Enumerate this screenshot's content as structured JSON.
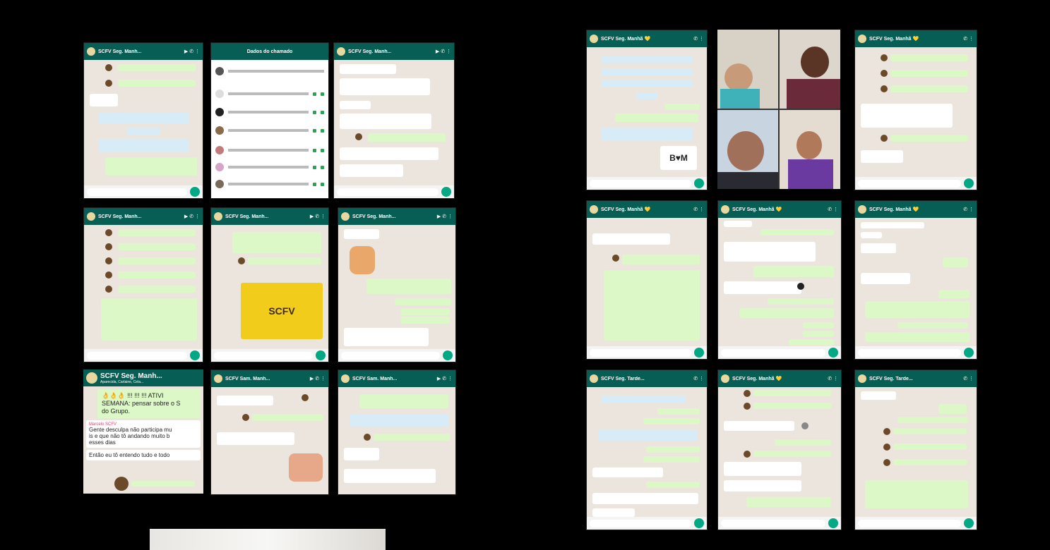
{
  "image": {
    "background": "#000000",
    "accent": "#075e54",
    "bubble_out": "#dcf8c6",
    "bubble_in": "#ffffff",
    "send_button": "#00a884"
  },
  "left_collage": {
    "row1": [
      {
        "title": "SCFV Seg. Manh..."
      },
      {
        "title": "Dados do chamado"
      },
      {
        "title": "SCFV Seg. Manh..."
      }
    ],
    "row2": [
      {
        "title": "SCFV Seg. Manh..."
      },
      {
        "title": "SCFV Seg. Manh..."
      },
      {
        "title": "SCFV Seg. Manh..."
      }
    ],
    "row3": [
      {
        "title": "SCFV Seg. Manh...",
        "subtitle": "Aparecida, Carlaine, Cela...",
        "emoji_line": "👌👌👌 !!! !!! !!! ATIVI",
        "text1": "SEMANA: pensar sobre o S",
        "text2": "do Grupo.",
        "sender": "Marcelo SCFV",
        "msg1": "Gente desculpa não participa mu",
        "msg2": "is e que não tô andando muito b",
        "msg3": "esses dias",
        "msg4": "Então eu tô entendo tudo e todo"
      },
      {
        "title": "SCFV Sam. Manh..."
      },
      {
        "title": "SCFV Sam. Manh..."
      }
    ],
    "poster_text": "SCFV"
  },
  "right_collage": {
    "row1": [
      {
        "title": "SCFV Seg. Manhã 💛"
      },
      {
        "title": ""
      },
      {
        "title": "SCFV Seg. Manhã 💛"
      }
    ],
    "row2": [
      {
        "title": "SCFV Seg. Manhã 💛"
      },
      {
        "title": "SCFV Seg. Manhã 💛"
      },
      {
        "title": "SCFV Seg. Manhã 💛"
      }
    ],
    "row3": [
      {
        "title": "SCFV Seg. Tarde..."
      },
      {
        "title": "SCFV Seg. Manhã 💛"
      },
      {
        "title": "SCFV Seg. Tarde..."
      }
    ],
    "sticker": "B♥M"
  }
}
